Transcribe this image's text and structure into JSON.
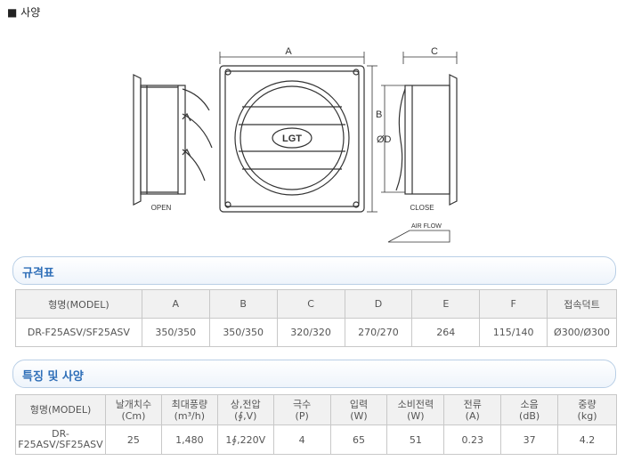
{
  "spec_heading": "■ 사양",
  "drawing": {
    "label_a": "A",
    "label_b": "B",
    "label_c": "C",
    "label_d": "ØD",
    "label_open": "OPEN",
    "label_close": "CLOSE",
    "label_airflow": "AIR FLOW",
    "logo": "LGT"
  },
  "section1": {
    "title": "규격표"
  },
  "table1": {
    "headers": [
      "형명(MODEL)",
      "A",
      "B",
      "C",
      "D",
      "E",
      "F",
      "접속덕트"
    ],
    "row": [
      "DR-F25ASV/SF25ASV",
      "350/350",
      "350/350",
      "320/320",
      "270/270",
      "264",
      "115/140",
      "Ø300/Ø300"
    ]
  },
  "section2": {
    "title": "특징 및 사양"
  },
  "table2": {
    "headers": [
      {
        "l1": "형명(MODEL)",
        "l2": ""
      },
      {
        "l1": "날개치수",
        "l2": "(Cm)"
      },
      {
        "l1": "최대풍량",
        "l2": "(m³/h)"
      },
      {
        "l1": "상,전압",
        "l2": "(∮,V)"
      },
      {
        "l1": "극수",
        "l2": "(P)"
      },
      {
        "l1": "입력",
        "l2": "(W)"
      },
      {
        "l1": "소비전력",
        "l2": "(W)"
      },
      {
        "l1": "전류",
        "l2": "(A)"
      },
      {
        "l1": "소음",
        "l2": "(dB)"
      },
      {
        "l1": "중량",
        "l2": "(kg)"
      }
    ],
    "row": [
      "DR-\nF25ASV/SF25ASV",
      "25",
      "1,480",
      "1∮,220V",
      "4",
      "65",
      "51",
      "0.23",
      "37",
      "4.2"
    ]
  }
}
